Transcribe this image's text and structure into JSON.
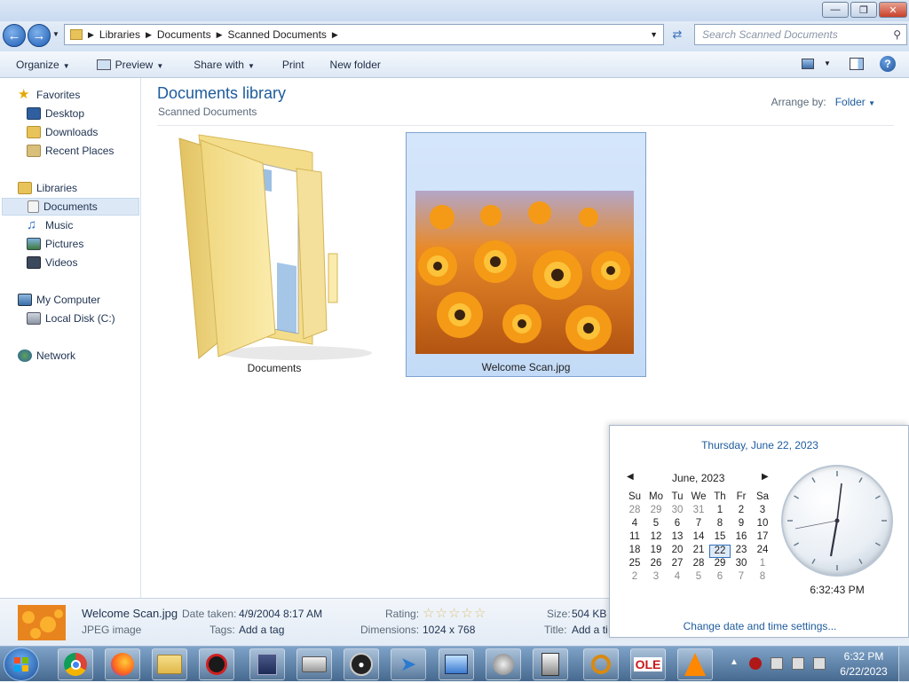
{
  "address": {
    "crumbs": [
      "Libraries",
      "Documents",
      "Scanned Documents"
    ],
    "search_placeholder": "Search Scanned Documents"
  },
  "toolbar": {
    "organize": "Organize",
    "preview": "Preview",
    "share_with": "Share with",
    "print": "Print",
    "new_folder": "New folder"
  },
  "nav": {
    "favorites": "Favorites",
    "desktop": "Desktop",
    "downloads": "Downloads",
    "recent_places": "Recent Places",
    "libraries": "Libraries",
    "documents": "Documents",
    "music": "Music",
    "pictures": "Pictures",
    "videos": "Videos",
    "my_computer": "My Computer",
    "local_disk": "Local Disk (C:)",
    "network": "Network"
  },
  "content": {
    "title": "Documents library",
    "subtitle": "Scanned Documents",
    "arrange_label": "Arrange by:",
    "arrange_value": "Folder",
    "items": [
      "Documents",
      "Welcome Scan.jpg"
    ]
  },
  "details": {
    "filename": "Welcome Scan.jpg",
    "filetype": "JPEG image",
    "date_taken_label": "Date taken:",
    "date_taken": "4/9/2004 8:17 AM",
    "tags_label": "Tags:",
    "tags": "Add a tag",
    "rating_label": "Rating:",
    "rating": 0,
    "dimensions_label": "Dimensions:",
    "dimensions": "1024 x 768",
    "size_label": "Size:",
    "size": "504 KB",
    "title_label": "Title:",
    "title_value": "Add a ti"
  },
  "calendar": {
    "full_date": "Thursday, June 22, 2023",
    "month_label": "June, 2023",
    "weekdays": [
      "Su",
      "Mo",
      "Tu",
      "We",
      "Th",
      "Fr",
      "Sa"
    ],
    "weeks": [
      [
        "28",
        "29",
        "30",
        "31",
        "1",
        "2",
        "3"
      ],
      [
        "4",
        "5",
        "6",
        "7",
        "8",
        "9",
        "10"
      ],
      [
        "11",
        "12",
        "13",
        "14",
        "15",
        "16",
        "17"
      ],
      [
        "18",
        "19",
        "20",
        "21",
        "22",
        "23",
        "24"
      ],
      [
        "25",
        "26",
        "27",
        "28",
        "29",
        "30",
        "1"
      ],
      [
        "2",
        "3",
        "4",
        "5",
        "6",
        "7",
        "8"
      ]
    ],
    "today": "22",
    "time": "6:32:43 PM",
    "settings_link": "Change date and time settings..."
  },
  "taskbar": {
    "tray_time": "6:32 PM",
    "tray_date": "6/22/2023"
  },
  "colors": {
    "accent": "#1e5b9c",
    "selection": "#c4dbf7",
    "taskbar": "#46698f"
  }
}
